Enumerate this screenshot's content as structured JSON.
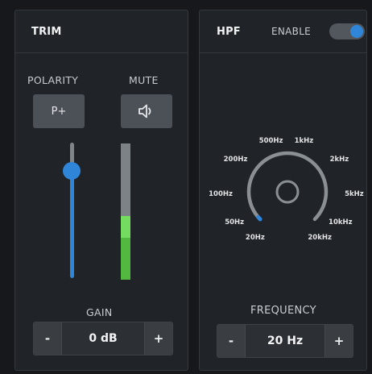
{
  "trim": {
    "title": "TRIM",
    "polarity_label": "POLARITY",
    "polarity_button": "P+",
    "mute_label": "MUTE",
    "mute_icon": "speaker-icon",
    "gain_label": "GAIN",
    "gain_value": "0 dB",
    "gain_slider_level": 0.79,
    "meter_level": 0.47,
    "minus": "-",
    "plus": "+"
  },
  "hpf": {
    "title": "HPF",
    "enable_label": "ENABLE",
    "enabled": true,
    "frequency_label": "FREQUENCY",
    "frequency_value": "20 Hz",
    "knob_level": 0.0,
    "dial_labels": [
      "20Hz",
      "50Hz",
      "100Hz",
      "200Hz",
      "500Hz",
      "1kHz",
      "2kHz",
      "5kHz",
      "10kHz",
      "20kHz"
    ],
    "minus": "-",
    "plus": "+"
  },
  "colors": {
    "accent_blue": "#2f86d8",
    "meter_green": "#74dd60",
    "panel_bg": "#202327"
  }
}
